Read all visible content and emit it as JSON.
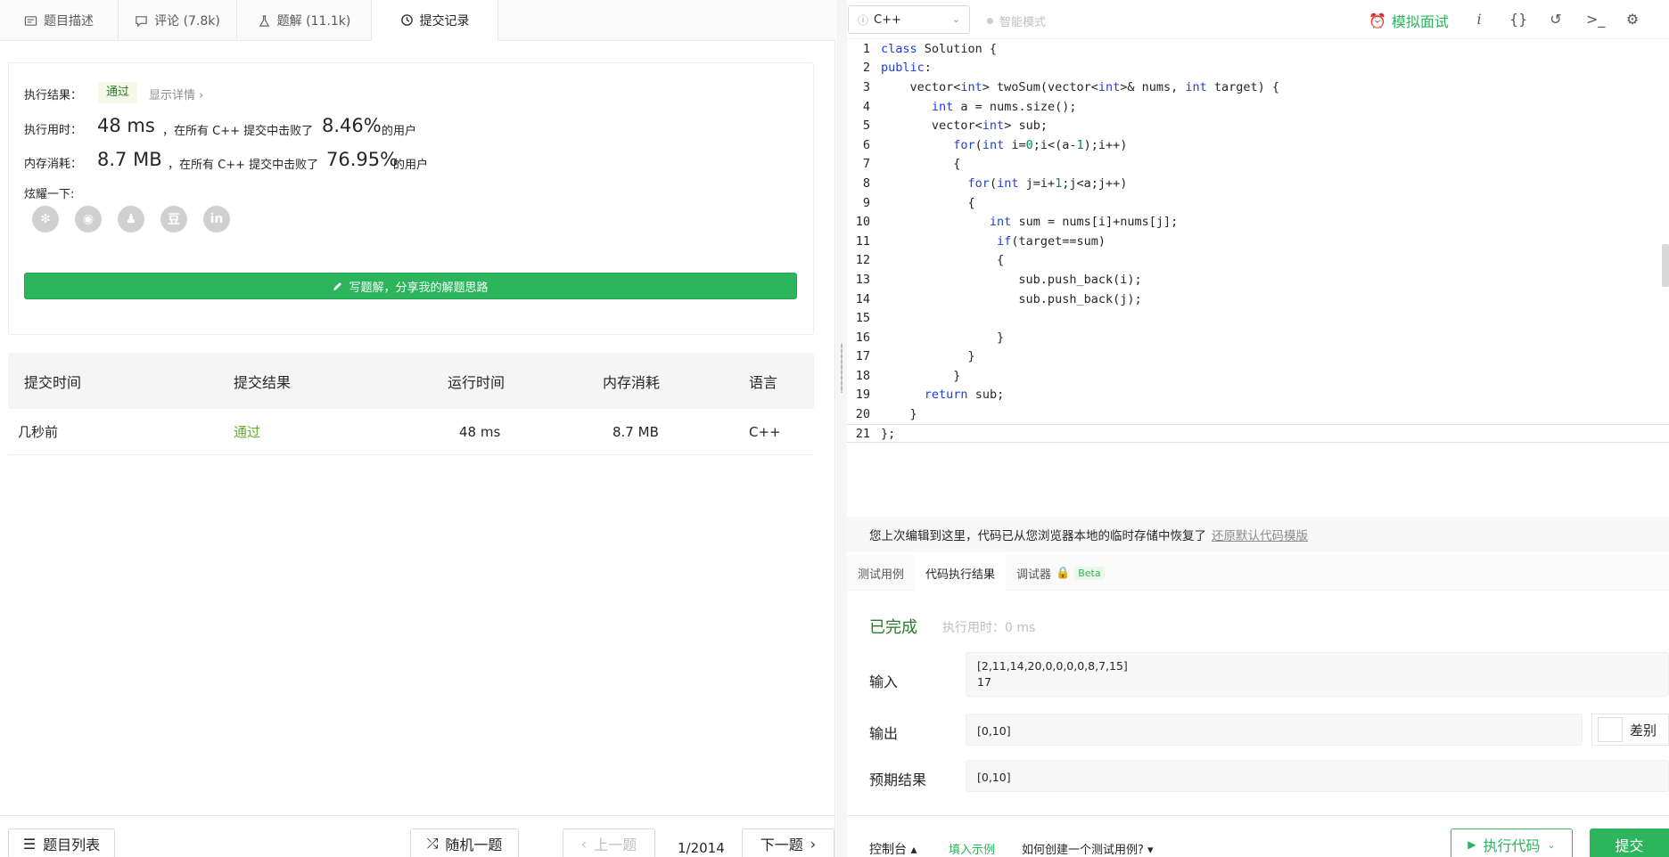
{
  "left_tabs": [
    {
      "label": "题目描述",
      "icon": "description-icon"
    },
    {
      "label": "评论 (7.8k)",
      "icon": "comment-icon"
    },
    {
      "label": "题解 (11.1k)",
      "icon": "flask-icon"
    },
    {
      "label": "提交记录",
      "icon": "clock-icon"
    }
  ],
  "result": {
    "result_label": "执行结果：",
    "status": "通过",
    "detail": "显示详情 ›",
    "time_label": "执行用时：",
    "time_value": "48 ms",
    "time_text": "，在所有 C++ 提交中击败了",
    "time_pct": "8.46%",
    "mem_label": "内存消耗：",
    "mem_value": "8.7 MB",
    "mem_text": "，在所有 C++ 提交中击败了",
    "mem_pct": "76.95%",
    "users_text": "的用户",
    "share_label": "炫耀一下:",
    "share_icons": [
      "wechat-icon",
      "weibo-icon",
      "qq-icon",
      "douban-icon",
      "linkedin-icon"
    ],
    "share_glyphs": [
      "✻",
      "◉",
      "♟",
      "豆",
      "in"
    ],
    "write_button": "写题解，分享我的解题思路"
  },
  "submissions": {
    "headers": [
      "提交时间",
      "提交结果",
      "运行时间",
      "内存消耗",
      "语言"
    ],
    "rows": [
      {
        "time": "几秒前",
        "result": "通过",
        "runtime": "48 ms",
        "memory": "8.7 MB",
        "lang": "C++"
      }
    ]
  },
  "left_footer": {
    "list_button": "题目列表",
    "random_button": "随机一题",
    "prev_button": "上一题",
    "pager": "1/2014",
    "next_button": "下一题"
  },
  "toolbar": {
    "language": "C++",
    "smart_mode": "智能模式",
    "mock_interview": "模拟面试",
    "icons": [
      "info-icon",
      "braces-icon",
      "undo-icon",
      "terminal-icon",
      "settings-icon"
    ],
    "icon_glyphs": [
      "i",
      "{}",
      "↺",
      ">_",
      "⚙"
    ]
  },
  "code_lines": [
    "class Solution {",
    "public:",
    "    vector<int> twoSum(vector<int>& nums, int target) {",
    "       int a = nums.size();",
    "       vector<int> sub;",
    "          for(int i=0;i<(a-1);i++)",
    "          {",
    "            for(int j=i+1;j<a;j++)",
    "            {",
    "               int sum = nums[i]+nums[j];",
    "                if(target==sum)",
    "                {",
    "                   sub.push_back(i);",
    "                   sub.push_back(j);",
    "",
    "                }",
    "            }",
    "          }",
    "      return sub;",
    "    }",
    "};"
  ],
  "restore_bar": {
    "text": "您上次编辑到这里，代码已从您浏览器本地的临时存储中恢复了",
    "link": "还原默认代码模版"
  },
  "console_tabs": [
    "测试用例",
    "代码执行结果",
    "调试器"
  ],
  "beta_label": "Beta",
  "console": {
    "status": "已完成",
    "exec_time": "执行用时：0 ms",
    "input_label": "输入",
    "input_line1": "[2,11,14,20,0,0,0,0,8,7,15]",
    "input_line2": "17",
    "output_label": "输出",
    "output_value": "[0,10]",
    "diff_label": "差别",
    "expected_label": "预期结果",
    "expected_value": "[0,10]"
  },
  "right_footer": {
    "console_label": "控制台 ▴",
    "fill_example": "填入示例",
    "how_to": "如何创建一个测试用例? ▾",
    "run_button": "执行代码",
    "submit_button": "提交"
  },
  "colors": {
    "accent": "#2db55d",
    "pass": "#5fb02b",
    "keyword": "#1f3fd8"
  }
}
